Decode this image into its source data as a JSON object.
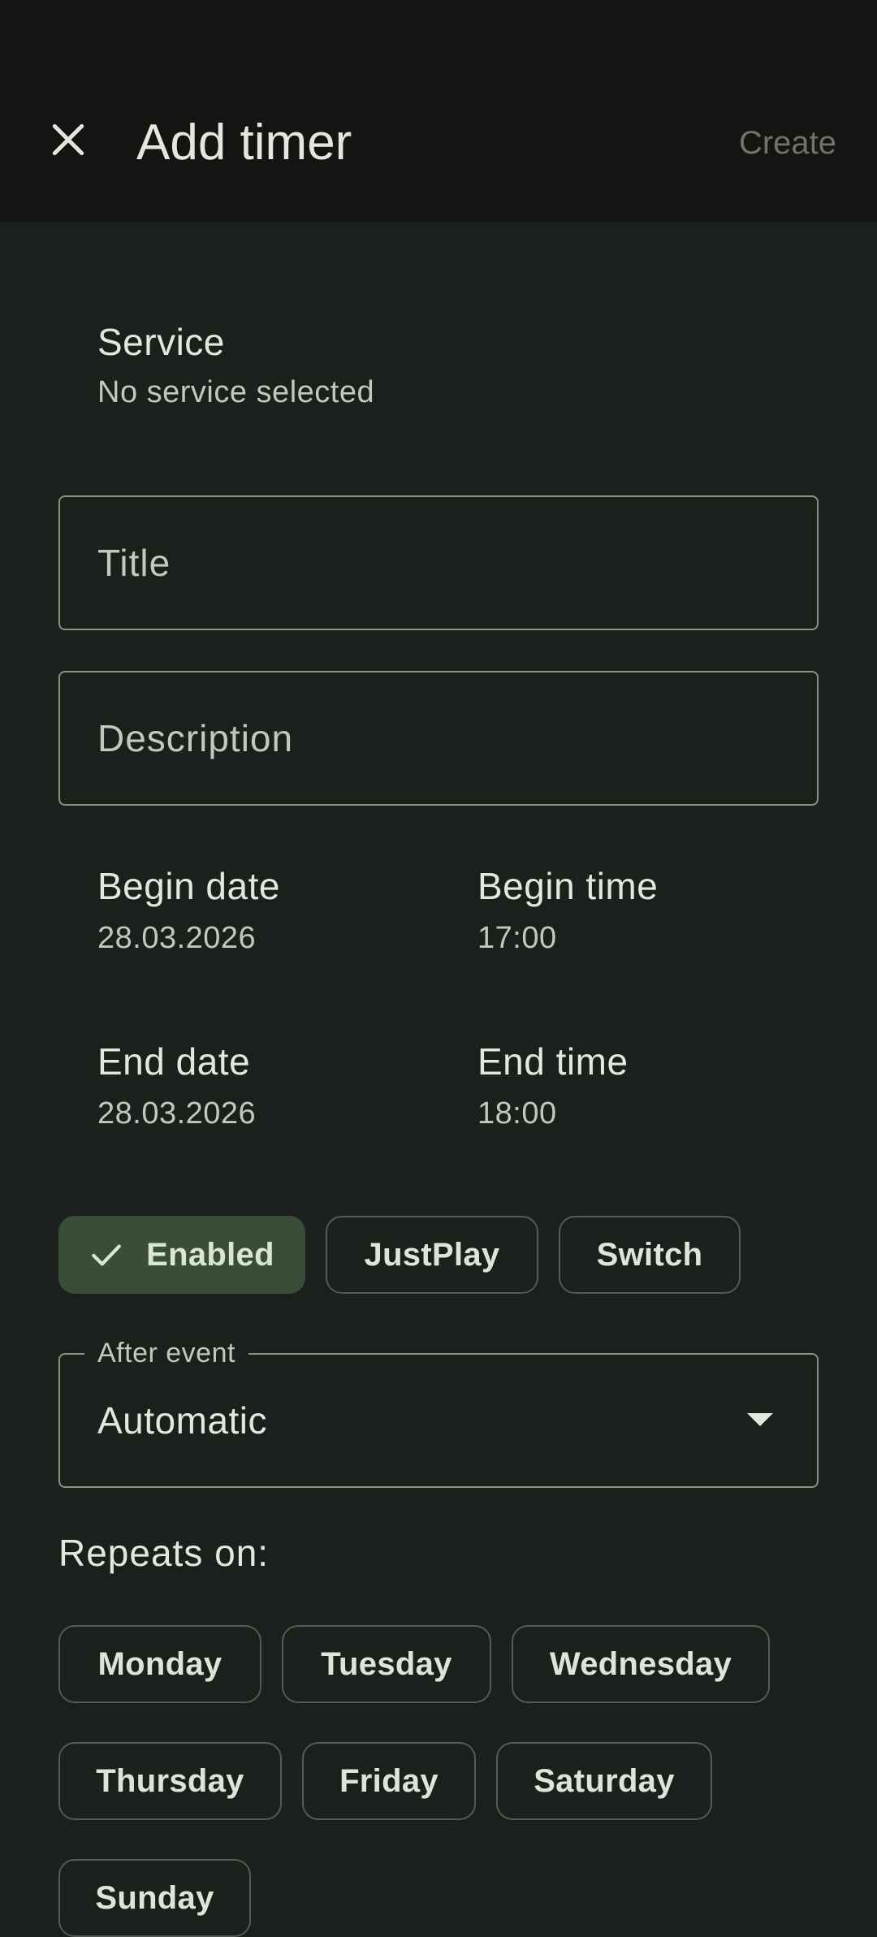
{
  "appbar": {
    "title": "Add timer",
    "create_label": "Create",
    "close_icon": "close-icon"
  },
  "service": {
    "label": "Service",
    "value": "No service selected"
  },
  "fields": {
    "title_placeholder": "Title",
    "description_placeholder": "Description"
  },
  "schedule": {
    "begin_date_label": "Begin date",
    "begin_date_value": "28.03.2026",
    "begin_time_label": "Begin time",
    "begin_time_value": "17:00",
    "end_date_label": "End date",
    "end_date_value": "28.03.2026",
    "end_time_label": "End time",
    "end_time_value": "18:00"
  },
  "options": {
    "enabled_label": "Enabled",
    "enabled_selected": true,
    "justplay_label": "JustPlay",
    "switch_label": "Switch"
  },
  "after_event": {
    "label": "After event",
    "value": "Automatic"
  },
  "repeats": {
    "label": "Repeats on:",
    "days": [
      "Monday",
      "Tuesday",
      "Wednesday",
      "Thursday",
      "Friday",
      "Saturday",
      "Sunday"
    ]
  },
  "colors": {
    "background": "#1c201c",
    "appbar": "#121512",
    "selected_chip": "#3b4d39",
    "outline": "#8c9187"
  }
}
